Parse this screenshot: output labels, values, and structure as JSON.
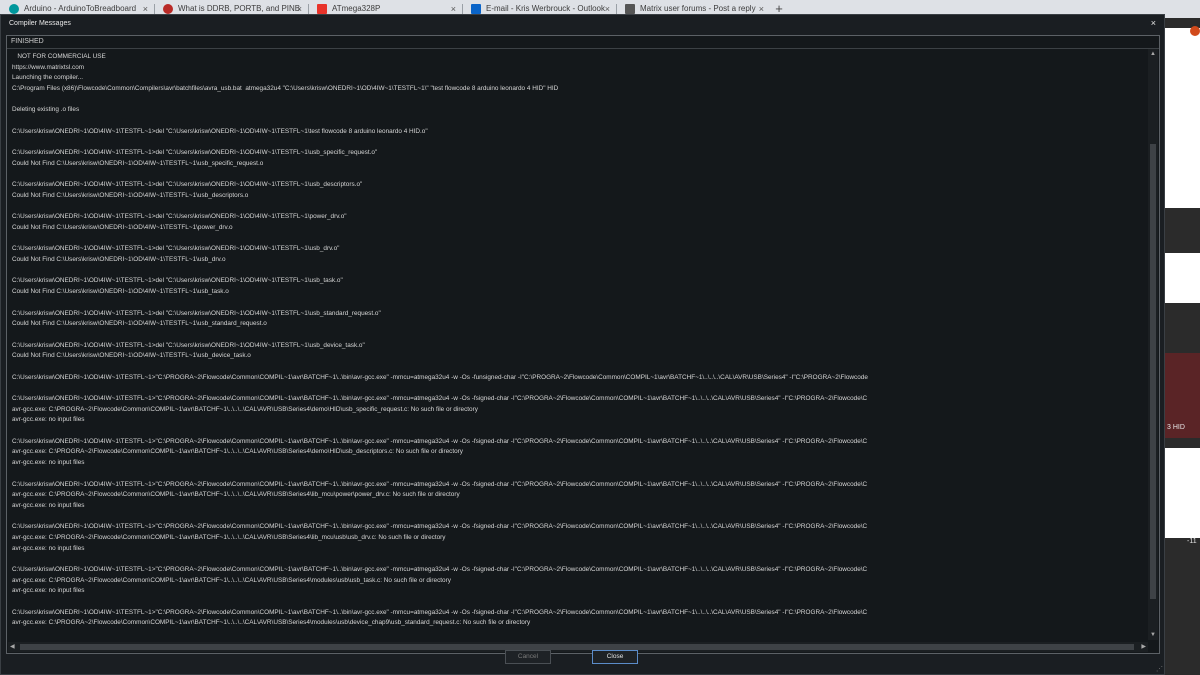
{
  "browser_tabs": [
    {
      "label": "Arduino - ArduinoToBreadboard",
      "icon": "arduino-icon",
      "color": "#00979c"
    },
    {
      "label": "What is DDRB, PORTB, and PINB",
      "icon": "quora-icon",
      "color": "#b92b27"
    },
    {
      "label": "ATmega328P",
      "icon": "microchip-icon",
      "color": "#e8332a"
    },
    {
      "label": "E-mail - Kris Werbrouck - Outlook",
      "icon": "outlook-icon",
      "color": "#0a64c8"
    },
    {
      "label": "Matrix user forums - Post a reply",
      "icon": "forum-icon",
      "color": "#555555"
    }
  ],
  "newtab_label": "+",
  "tab_close_glyph": "×",
  "background_app": {
    "hid_text": "3 HID",
    "number_text": "-11"
  },
  "dialog": {
    "title": "Compiler Messages",
    "close_glyph": "×",
    "status": "FINISHED",
    "log_lines": [
      "   NOT FOR COMMERCIAL USE",
      "https://www.matrixtsl.com",
      "Launching the compiler...",
      "C:\\Program Files (x86)\\Flowcode\\Common\\Compilers\\avr\\batchfiles\\avra_usb.bat  atmega32u4 \"C:\\Users\\krisw\\ONEDRI~1\\OD\\4IW~1\\TESTFL~1\\\" \"test flowcode 8 arduino leonardo 4 HID\" HID",
      "",
      "Deleting existing .o files",
      "",
      "C:\\Users\\krisw\\ONEDRI~1\\OD\\4IW~1\\TESTFL~1>del \"C:\\Users\\krisw\\ONEDRI~1\\OD\\4IW~1\\TESTFL~1\\test flowcode 8 arduino leonardo 4 HID.o\"",
      "",
      "C:\\Users\\krisw\\ONEDRI~1\\OD\\4IW~1\\TESTFL~1>del \"C:\\Users\\krisw\\ONEDRI~1\\OD\\4IW~1\\TESTFL~1\\usb_specific_request.o\"",
      "Could Not Find C:\\Users\\krisw\\ONEDRI~1\\OD\\4IW~1\\TESTFL~1\\usb_specific_request.o",
      "",
      "C:\\Users\\krisw\\ONEDRI~1\\OD\\4IW~1\\TESTFL~1>del \"C:\\Users\\krisw\\ONEDRI~1\\OD\\4IW~1\\TESTFL~1\\usb_descriptors.o\"",
      "Could Not Find C:\\Users\\krisw\\ONEDRI~1\\OD\\4IW~1\\TESTFL~1\\usb_descriptors.o",
      "",
      "C:\\Users\\krisw\\ONEDRI~1\\OD\\4IW~1\\TESTFL~1>del \"C:\\Users\\krisw\\ONEDRI~1\\OD\\4IW~1\\TESTFL~1\\power_drv.o\"",
      "Could Not Find C:\\Users\\krisw\\ONEDRI~1\\OD\\4IW~1\\TESTFL~1\\power_drv.o",
      "",
      "C:\\Users\\krisw\\ONEDRI~1\\OD\\4IW~1\\TESTFL~1>del \"C:\\Users\\krisw\\ONEDRI~1\\OD\\4IW~1\\TESTFL~1\\usb_drv.o\"",
      "Could Not Find C:\\Users\\krisw\\ONEDRI~1\\OD\\4IW~1\\TESTFL~1\\usb_drv.o",
      "",
      "C:\\Users\\krisw\\ONEDRI~1\\OD\\4IW~1\\TESTFL~1>del \"C:\\Users\\krisw\\ONEDRI~1\\OD\\4IW~1\\TESTFL~1\\usb_task.o\"",
      "Could Not Find C:\\Users\\krisw\\ONEDRI~1\\OD\\4IW~1\\TESTFL~1\\usb_task.o",
      "",
      "C:\\Users\\krisw\\ONEDRI~1\\OD\\4IW~1\\TESTFL~1>del \"C:\\Users\\krisw\\ONEDRI~1\\OD\\4IW~1\\TESTFL~1\\usb_standard_request.o\"",
      "Could Not Find C:\\Users\\krisw\\ONEDRI~1\\OD\\4IW~1\\TESTFL~1\\usb_standard_request.o",
      "",
      "C:\\Users\\krisw\\ONEDRI~1\\OD\\4IW~1\\TESTFL~1>del \"C:\\Users\\krisw\\ONEDRI~1\\OD\\4IW~1\\TESTFL~1\\usb_device_task.o\"",
      "Could Not Find C:\\Users\\krisw\\ONEDRI~1\\OD\\4IW~1\\TESTFL~1\\usb_device_task.o",
      "",
      "C:\\Users\\krisw\\ONEDRI~1\\OD\\4IW~1\\TESTFL~1>\"C:\\PROGRA~2\\Flowcode\\Common\\COMPIL~1\\avr\\BATCHF~1\\..\\bin\\avr-gcc.exe\" -mmcu=atmega32u4 -w -Os -funsigned-char -I\"C:\\PROGRA~2\\Flowcode\\Common\\COMPIL~1\\avr\\BATCHF~1\\..\\..\\..\\CAL\\AVR\\USB\\Series4\" -I\"C:\\PROGRA~2\\Flowcode",
      "",
      "C:\\Users\\krisw\\ONEDRI~1\\OD\\4IW~1\\TESTFL~1>\"C:\\PROGRA~2\\Flowcode\\Common\\COMPIL~1\\avr\\BATCHF~1\\..\\bin\\avr-gcc.exe\" -mmcu=atmega32u4 -w -Os -fsigned-char -I\"C:\\PROGRA~2\\Flowcode\\Common\\COMPIL~1\\avr\\BATCHF~1\\..\\..\\..\\CAL\\AVR\\USB\\Series4\" -I\"C:\\PROGRA~2\\Flowcode\\C",
      "avr-gcc.exe: C:\\PROGRA~2\\Flowcode\\Common\\COMPIL~1\\avr\\BATCHF~1\\..\\..\\..\\CAL\\AVR\\USB\\Series4\\demo\\HID\\usb_specific_request.c: No such file or directory",
      "avr-gcc.exe: no input files",
      "",
      "C:\\Users\\krisw\\ONEDRI~1\\OD\\4IW~1\\TESTFL~1>\"C:\\PROGRA~2\\Flowcode\\Common\\COMPIL~1\\avr\\BATCHF~1\\..\\bin\\avr-gcc.exe\" -mmcu=atmega32u4 -w -Os -fsigned-char -I\"C:\\PROGRA~2\\Flowcode\\Common\\COMPIL~1\\avr\\BATCHF~1\\..\\..\\..\\CAL\\AVR\\USB\\Series4\" -I\"C:\\PROGRA~2\\Flowcode\\C",
      "avr-gcc.exe: C:\\PROGRA~2\\Flowcode\\Common\\COMPIL~1\\avr\\BATCHF~1\\..\\..\\..\\CAL\\AVR\\USB\\Series4\\demo\\HID\\usb_descriptors.c: No such file or directory",
      "avr-gcc.exe: no input files",
      "",
      "C:\\Users\\krisw\\ONEDRI~1\\OD\\4IW~1\\TESTFL~1>\"C:\\PROGRA~2\\Flowcode\\Common\\COMPIL~1\\avr\\BATCHF~1\\..\\bin\\avr-gcc.exe\" -mmcu=atmega32u4 -w -Os -fsigned-char -I\"C:\\PROGRA~2\\Flowcode\\Common\\COMPIL~1\\avr\\BATCHF~1\\..\\..\\..\\CAL\\AVR\\USB\\Series4\" -I\"C:\\PROGRA~2\\Flowcode\\C",
      "avr-gcc.exe: C:\\PROGRA~2\\Flowcode\\Common\\COMPIL~1\\avr\\BATCHF~1\\..\\..\\..\\CAL\\AVR\\USB\\Series4\\lib_mcu\\power\\power_drv.c: No such file or directory",
      "avr-gcc.exe: no input files",
      "",
      "C:\\Users\\krisw\\ONEDRI~1\\OD\\4IW~1\\TESTFL~1>\"C:\\PROGRA~2\\Flowcode\\Common\\COMPIL~1\\avr\\BATCHF~1\\..\\bin\\avr-gcc.exe\" -mmcu=atmega32u4 -w -Os -fsigned-char -I\"C:\\PROGRA~2\\Flowcode\\Common\\COMPIL~1\\avr\\BATCHF~1\\..\\..\\..\\CAL\\AVR\\USB\\Series4\" -I\"C:\\PROGRA~2\\Flowcode\\C",
      "avr-gcc.exe: C:\\PROGRA~2\\Flowcode\\Common\\COMPIL~1\\avr\\BATCHF~1\\..\\..\\..\\CAL\\AVR\\USB\\Series4\\lib_mcu\\usb\\usb_drv.c: No such file or directory",
      "avr-gcc.exe: no input files",
      "",
      "C:\\Users\\krisw\\ONEDRI~1\\OD\\4IW~1\\TESTFL~1>\"C:\\PROGRA~2\\Flowcode\\Common\\COMPIL~1\\avr\\BATCHF~1\\..\\bin\\avr-gcc.exe\" -mmcu=atmega32u4 -w -Os -fsigned-char -I\"C:\\PROGRA~2\\Flowcode\\Common\\COMPIL~1\\avr\\BATCHF~1\\..\\..\\..\\CAL\\AVR\\USB\\Series4\" -I\"C:\\PROGRA~2\\Flowcode\\C",
      "avr-gcc.exe: C:\\PROGRA~2\\Flowcode\\Common\\COMPIL~1\\avr\\BATCHF~1\\..\\..\\..\\CAL\\AVR\\USB\\Series4\\modules\\usb\\usb_task.c: No such file or directory",
      "avr-gcc.exe: no input files",
      "",
      "C:\\Users\\krisw\\ONEDRI~1\\OD\\4IW~1\\TESTFL~1>\"C:\\PROGRA~2\\Flowcode\\Common\\COMPIL~1\\avr\\BATCHF~1\\..\\bin\\avr-gcc.exe\" -mmcu=atmega32u4 -w -Os -fsigned-char -I\"C:\\PROGRA~2\\Flowcode\\Common\\COMPIL~1\\avr\\BATCHF~1\\..\\..\\..\\CAL\\AVR\\USB\\Series4\" -I\"C:\\PROGRA~2\\Flowcode\\C",
      "avr-gcc.exe: C:\\PROGRA~2\\Flowcode\\Common\\COMPIL~1\\avr\\BATCHF~1\\..\\..\\..\\CAL\\AVR\\USB\\Series4\\modules\\usb\\device_chap9\\usb_standard_request.c: No such file or directory"
    ],
    "buttons": {
      "cancel_label": "Cancel",
      "close_label": "Close"
    },
    "scroll": {
      "up_glyph": "▲",
      "down_glyph": "▼",
      "left_glyph": "◀",
      "right_glyph": "▶"
    }
  }
}
